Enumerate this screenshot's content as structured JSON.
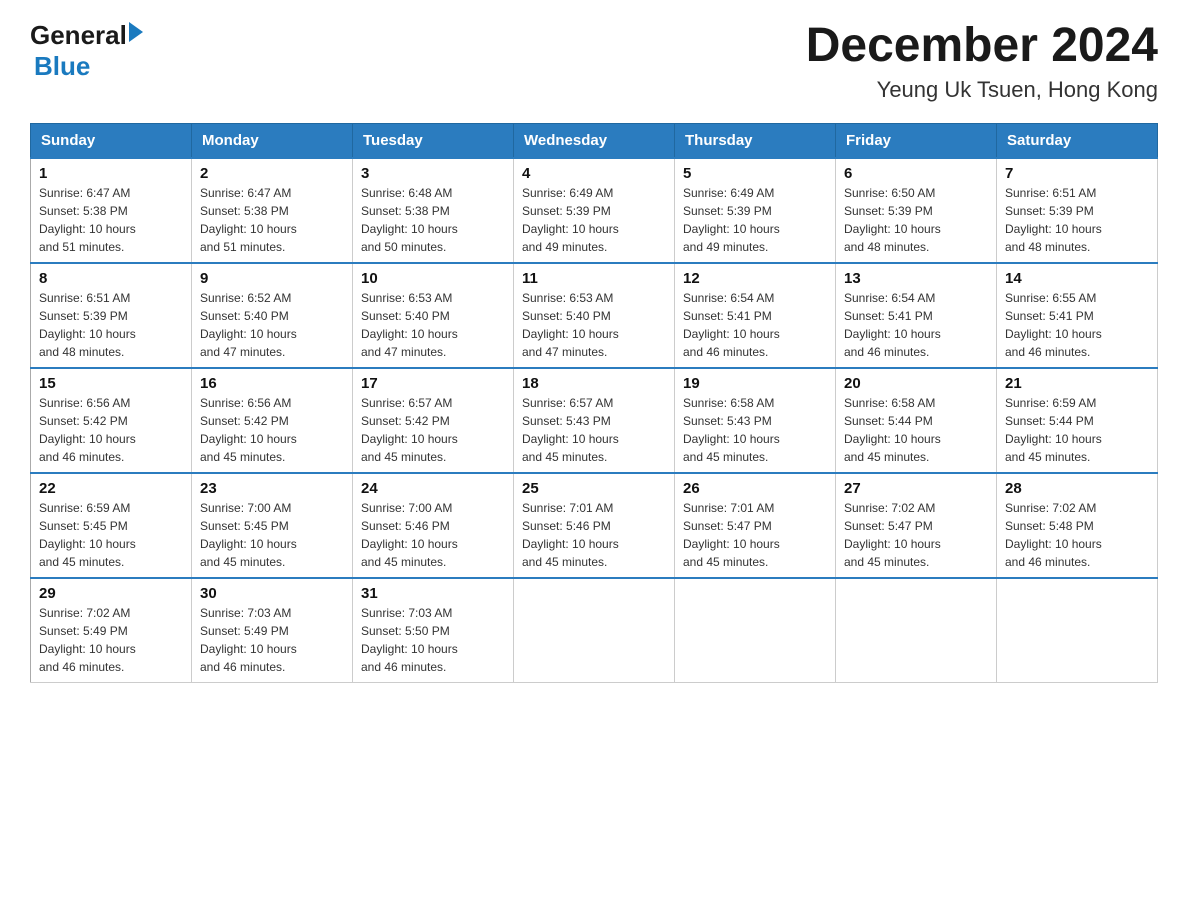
{
  "header": {
    "logo_general": "General",
    "logo_blue": "Blue",
    "month_title": "December 2024",
    "location": "Yeung Uk Tsuen, Hong Kong"
  },
  "days_of_week": [
    "Sunday",
    "Monday",
    "Tuesday",
    "Wednesday",
    "Thursday",
    "Friday",
    "Saturday"
  ],
  "weeks": [
    [
      {
        "day": "1",
        "info": "Sunrise: 6:47 AM\nSunset: 5:38 PM\nDaylight: 10 hours\nand 51 minutes."
      },
      {
        "day": "2",
        "info": "Sunrise: 6:47 AM\nSunset: 5:38 PM\nDaylight: 10 hours\nand 51 minutes."
      },
      {
        "day": "3",
        "info": "Sunrise: 6:48 AM\nSunset: 5:38 PM\nDaylight: 10 hours\nand 50 minutes."
      },
      {
        "day": "4",
        "info": "Sunrise: 6:49 AM\nSunset: 5:39 PM\nDaylight: 10 hours\nand 49 minutes."
      },
      {
        "day": "5",
        "info": "Sunrise: 6:49 AM\nSunset: 5:39 PM\nDaylight: 10 hours\nand 49 minutes."
      },
      {
        "day": "6",
        "info": "Sunrise: 6:50 AM\nSunset: 5:39 PM\nDaylight: 10 hours\nand 48 minutes."
      },
      {
        "day": "7",
        "info": "Sunrise: 6:51 AM\nSunset: 5:39 PM\nDaylight: 10 hours\nand 48 minutes."
      }
    ],
    [
      {
        "day": "8",
        "info": "Sunrise: 6:51 AM\nSunset: 5:39 PM\nDaylight: 10 hours\nand 48 minutes."
      },
      {
        "day": "9",
        "info": "Sunrise: 6:52 AM\nSunset: 5:40 PM\nDaylight: 10 hours\nand 47 minutes."
      },
      {
        "day": "10",
        "info": "Sunrise: 6:53 AM\nSunset: 5:40 PM\nDaylight: 10 hours\nand 47 minutes."
      },
      {
        "day": "11",
        "info": "Sunrise: 6:53 AM\nSunset: 5:40 PM\nDaylight: 10 hours\nand 47 minutes."
      },
      {
        "day": "12",
        "info": "Sunrise: 6:54 AM\nSunset: 5:41 PM\nDaylight: 10 hours\nand 46 minutes."
      },
      {
        "day": "13",
        "info": "Sunrise: 6:54 AM\nSunset: 5:41 PM\nDaylight: 10 hours\nand 46 minutes."
      },
      {
        "day": "14",
        "info": "Sunrise: 6:55 AM\nSunset: 5:41 PM\nDaylight: 10 hours\nand 46 minutes."
      }
    ],
    [
      {
        "day": "15",
        "info": "Sunrise: 6:56 AM\nSunset: 5:42 PM\nDaylight: 10 hours\nand 46 minutes."
      },
      {
        "day": "16",
        "info": "Sunrise: 6:56 AM\nSunset: 5:42 PM\nDaylight: 10 hours\nand 45 minutes."
      },
      {
        "day": "17",
        "info": "Sunrise: 6:57 AM\nSunset: 5:42 PM\nDaylight: 10 hours\nand 45 minutes."
      },
      {
        "day": "18",
        "info": "Sunrise: 6:57 AM\nSunset: 5:43 PM\nDaylight: 10 hours\nand 45 minutes."
      },
      {
        "day": "19",
        "info": "Sunrise: 6:58 AM\nSunset: 5:43 PM\nDaylight: 10 hours\nand 45 minutes."
      },
      {
        "day": "20",
        "info": "Sunrise: 6:58 AM\nSunset: 5:44 PM\nDaylight: 10 hours\nand 45 minutes."
      },
      {
        "day": "21",
        "info": "Sunrise: 6:59 AM\nSunset: 5:44 PM\nDaylight: 10 hours\nand 45 minutes."
      }
    ],
    [
      {
        "day": "22",
        "info": "Sunrise: 6:59 AM\nSunset: 5:45 PM\nDaylight: 10 hours\nand 45 minutes."
      },
      {
        "day": "23",
        "info": "Sunrise: 7:00 AM\nSunset: 5:45 PM\nDaylight: 10 hours\nand 45 minutes."
      },
      {
        "day": "24",
        "info": "Sunrise: 7:00 AM\nSunset: 5:46 PM\nDaylight: 10 hours\nand 45 minutes."
      },
      {
        "day": "25",
        "info": "Sunrise: 7:01 AM\nSunset: 5:46 PM\nDaylight: 10 hours\nand 45 minutes."
      },
      {
        "day": "26",
        "info": "Sunrise: 7:01 AM\nSunset: 5:47 PM\nDaylight: 10 hours\nand 45 minutes."
      },
      {
        "day": "27",
        "info": "Sunrise: 7:02 AM\nSunset: 5:47 PM\nDaylight: 10 hours\nand 45 minutes."
      },
      {
        "day": "28",
        "info": "Sunrise: 7:02 AM\nSunset: 5:48 PM\nDaylight: 10 hours\nand 46 minutes."
      }
    ],
    [
      {
        "day": "29",
        "info": "Sunrise: 7:02 AM\nSunset: 5:49 PM\nDaylight: 10 hours\nand 46 minutes."
      },
      {
        "day": "30",
        "info": "Sunrise: 7:03 AM\nSunset: 5:49 PM\nDaylight: 10 hours\nand 46 minutes."
      },
      {
        "day": "31",
        "info": "Sunrise: 7:03 AM\nSunset: 5:50 PM\nDaylight: 10 hours\nand 46 minutes."
      },
      {
        "day": "",
        "info": ""
      },
      {
        "day": "",
        "info": ""
      },
      {
        "day": "",
        "info": ""
      },
      {
        "day": "",
        "info": ""
      }
    ]
  ]
}
